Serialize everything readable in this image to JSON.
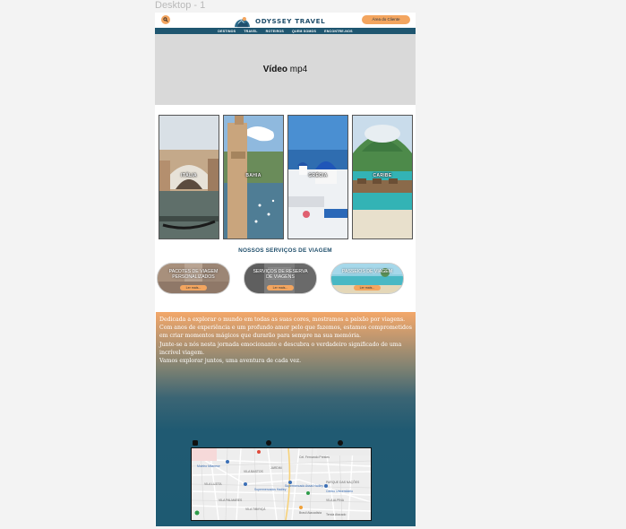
{
  "frame": {
    "title": "Desktop - 1"
  },
  "header": {
    "brand": "ODYSSEY TRAVEL",
    "client_button": "Área do Cliente",
    "nav": [
      "DESTINOS",
      "TRAVEL",
      "ROTEIROS",
      "QUEM SOMOS",
      "ENCONTRE-NOS"
    ]
  },
  "video": {
    "label_bold": "Vídeo",
    "label_rest": " mp4"
  },
  "destinations": [
    {
      "label": "ITÁLIA"
    },
    {
      "label": "BAHIA"
    },
    {
      "label": "GRÉCIA"
    },
    {
      "label": "CARIBE"
    }
  ],
  "services": {
    "title": "NOSSOS SERVIÇOS DE VIAGEM",
    "items": [
      {
        "text": "PACOTES DE VIAGEM PERSONALIZADOS",
        "button": "Ler mais..."
      },
      {
        "text": "SERVIÇOS DE RESERVA DE VIAGENS",
        "button": "Ler mais..."
      },
      {
        "text": "PASSEIOS DE VIAGEM",
        "button": "Ler mais..."
      }
    ]
  },
  "about": {
    "paragraphs": [
      "Dedicada a explorar o mundo em todas as suas cores, mostramos a paixão por viagens.",
      "Com anos de experiência e um profundo amor pelo que fazemos, estamos comprometidos em criar momentos mágicos que durarão para sempre na sua memória.",
      "Junte-se a nós nesta jornada emocionante e descubra o verdadeiro significado de uma incrível viagem.",
      "Vamos explorar juntos, uma aventura de cada vez."
    ]
  },
  "map": {
    "labels": [
      "Moinho Milanese",
      "VILA BASTOS",
      "Supermercado Assaí Hadley",
      "VILA ALPINA",
      "Cel. Fernando Prestes",
      "Supermercados Hadley",
      "VILA LUZITA",
      "VILA PALMARES",
      "Brasil Atacadista",
      "PARQUE DAS NAÇÕES",
      "JARDIM",
      "VILA TIBIRIÇÁ",
      "Centro Universitário",
      "Tenda Atacado"
    ]
  },
  "colors": {
    "accent": "#f3a55f",
    "navy": "#1f5670",
    "brand_text": "#1f4e6b"
  }
}
